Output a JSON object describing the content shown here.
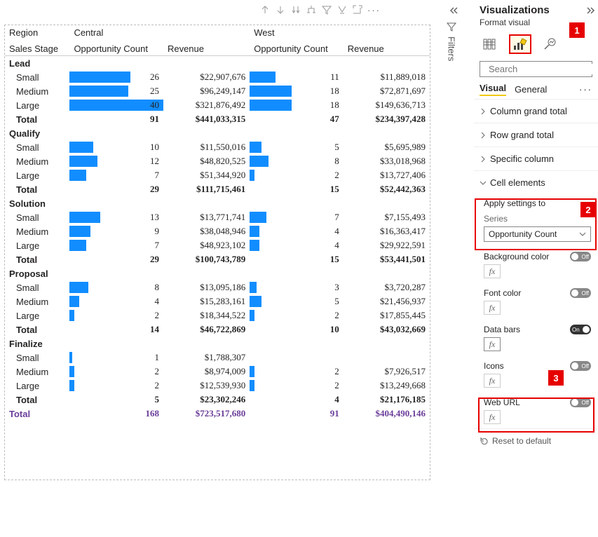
{
  "toolbar": {
    "more": "···"
  },
  "headers": {
    "region": "Region",
    "sales_stage": "Sales Stage",
    "central": "Central",
    "west": "West",
    "opp_count": "Opportunity Count",
    "revenue": "Revenue"
  },
  "max_oc": 40,
  "groups": [
    {
      "name": "Lead",
      "rows": [
        {
          "label": "Small",
          "c_oc": 26,
          "c_rev": "$22,907,676",
          "w_oc": 11,
          "w_rev": "$11,889,018"
        },
        {
          "label": "Medium",
          "c_oc": 25,
          "c_rev": "$96,249,147",
          "w_oc": 18,
          "w_rev": "$72,871,697"
        },
        {
          "label": "Large",
          "c_oc": 40,
          "c_rev": "$321,876,492",
          "w_oc": 18,
          "w_rev": "$149,636,713"
        }
      ],
      "total": {
        "label": "Total",
        "c_oc": "91",
        "c_rev": "$441,033,315",
        "w_oc": "47",
        "w_rev": "$234,397,428"
      }
    },
    {
      "name": "Qualify",
      "rows": [
        {
          "label": "Small",
          "c_oc": 10,
          "c_rev": "$11,550,016",
          "w_oc": 5,
          "w_rev": "$5,695,989"
        },
        {
          "label": "Medium",
          "c_oc": 12,
          "c_rev": "$48,820,525",
          "w_oc": 8,
          "w_rev": "$33,018,968"
        },
        {
          "label": "Large",
          "c_oc": 7,
          "c_rev": "$51,344,920",
          "w_oc": 2,
          "w_rev": "$13,727,406"
        }
      ],
      "total": {
        "label": "Total",
        "c_oc": "29",
        "c_rev": "$111,715,461",
        "w_oc": "15",
        "w_rev": "$52,442,363"
      }
    },
    {
      "name": "Solution",
      "rows": [
        {
          "label": "Small",
          "c_oc": 13,
          "c_rev": "$13,771,741",
          "w_oc": 7,
          "w_rev": "$7,155,493"
        },
        {
          "label": "Medium",
          "c_oc": 9,
          "c_rev": "$38,048,946",
          "w_oc": 4,
          "w_rev": "$16,363,417"
        },
        {
          "label": "Large",
          "c_oc": 7,
          "c_rev": "$48,923,102",
          "w_oc": 4,
          "w_rev": "$29,922,591"
        }
      ],
      "total": {
        "label": "Total",
        "c_oc": "29",
        "c_rev": "$100,743,789",
        "w_oc": "15",
        "w_rev": "$53,441,501"
      }
    },
    {
      "name": "Proposal",
      "rows": [
        {
          "label": "Small",
          "c_oc": 8,
          "c_rev": "$13,095,186",
          "w_oc": 3,
          "w_rev": "$3,720,287"
        },
        {
          "label": "Medium",
          "c_oc": 4,
          "c_rev": "$15,283,161",
          "w_oc": 5,
          "w_rev": "$21,456,937"
        },
        {
          "label": "Large",
          "c_oc": 2,
          "c_rev": "$18,344,522",
          "w_oc": 2,
          "w_rev": "$17,855,445"
        }
      ],
      "total": {
        "label": "Total",
        "c_oc": "14",
        "c_rev": "$46,722,869",
        "w_oc": "10",
        "w_rev": "$43,032,669"
      }
    },
    {
      "name": "Finalize",
      "rows": [
        {
          "label": "Small",
          "c_oc": 1,
          "c_rev": "$1,788,307",
          "w_oc": null,
          "w_rev": ""
        },
        {
          "label": "Medium",
          "c_oc": 2,
          "c_rev": "$8,974,009",
          "w_oc": 2,
          "w_rev": "$7,926,517"
        },
        {
          "label": "Large",
          "c_oc": 2,
          "c_rev": "$12,539,930",
          "w_oc": 2,
          "w_rev": "$13,249,668"
        }
      ],
      "total": {
        "label": "Total",
        "c_oc": "5",
        "c_rev": "$23,302,246",
        "w_oc": "4",
        "w_rev": "$21,176,185"
      }
    }
  ],
  "grand": {
    "label": "Total",
    "c_oc": "168",
    "c_rev": "$723,517,680",
    "w_oc": "91",
    "w_rev": "$404,490,146"
  },
  "panel": {
    "title": "Visualizations",
    "subtitle": "Format visual",
    "filters": "Filters",
    "search_placeholder": "Search",
    "tabs": {
      "visual": "Visual",
      "general": "General"
    },
    "acc": {
      "col_total": "Column grand total",
      "row_total": "Row grand total",
      "spec_col": "Specific column",
      "cell_el": "Cell elements"
    },
    "apply": "Apply settings to",
    "series_label": "Series",
    "series_value": "Opportunity Count",
    "toggles": {
      "bg": "Background color",
      "font": "Font color",
      "databars": "Data bars",
      "icons": "Icons",
      "weburl": "Web URL"
    },
    "on": "On",
    "off": "Off",
    "fx": "fx",
    "reset": "Reset to default"
  },
  "callouts": {
    "b1": "1",
    "b2": "2",
    "b3": "3"
  }
}
